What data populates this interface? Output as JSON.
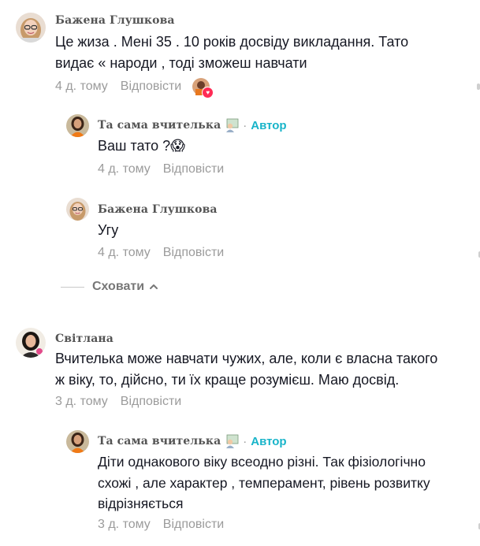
{
  "thread": {
    "comment1": {
      "author": "Бажена Глушкова",
      "text": "Це жиза . Мені 35 . 10 років досвіду викладання. Тато видає « народи , тоді зможеш навчати",
      "time": "4 д. тому",
      "reply": "Відповісти",
      "liked_by_author_icon": "heart-icon"
    },
    "reply1": {
      "author": "Та сама вчителька",
      "author_emoji": "teacher-emoji-icon",
      "separator": "·",
      "badge": "Автор",
      "text": "Ваш тато ?😱",
      "time": "4 д. тому",
      "reply": "Відповісти"
    },
    "reply2": {
      "author": "Бажена Глушкова",
      "text": "Угу",
      "time": "4 д. тому",
      "reply": "Відповісти"
    },
    "hide_replies": {
      "label": "Сховати",
      "icon": "chevron-up-icon"
    },
    "comment2": {
      "author": "Світлана",
      "text": "Вчителька може навчати чужих, але, коли є власна такого ж віку, то, дійсно, ти їх краще розумієш. Маю досвід.",
      "time": "3 д. тому",
      "reply": "Відповісти"
    },
    "reply3": {
      "author": "Та сама вчителька",
      "author_emoji": "teacher-emoji-icon",
      "separator": "·",
      "badge": "Автор",
      "text": "Діти однакового віку всеодно різні. Так фізіологічно схожі , але характер , темперамент, рівень розвитку відрізняється",
      "time": "3 д. тому",
      "reply": "Відповісти"
    }
  },
  "colors": {
    "badge": "#18b4c9",
    "meta": "#9b9b9b",
    "author": "#545454",
    "text": "#161823",
    "heart": "#ff2b55"
  }
}
